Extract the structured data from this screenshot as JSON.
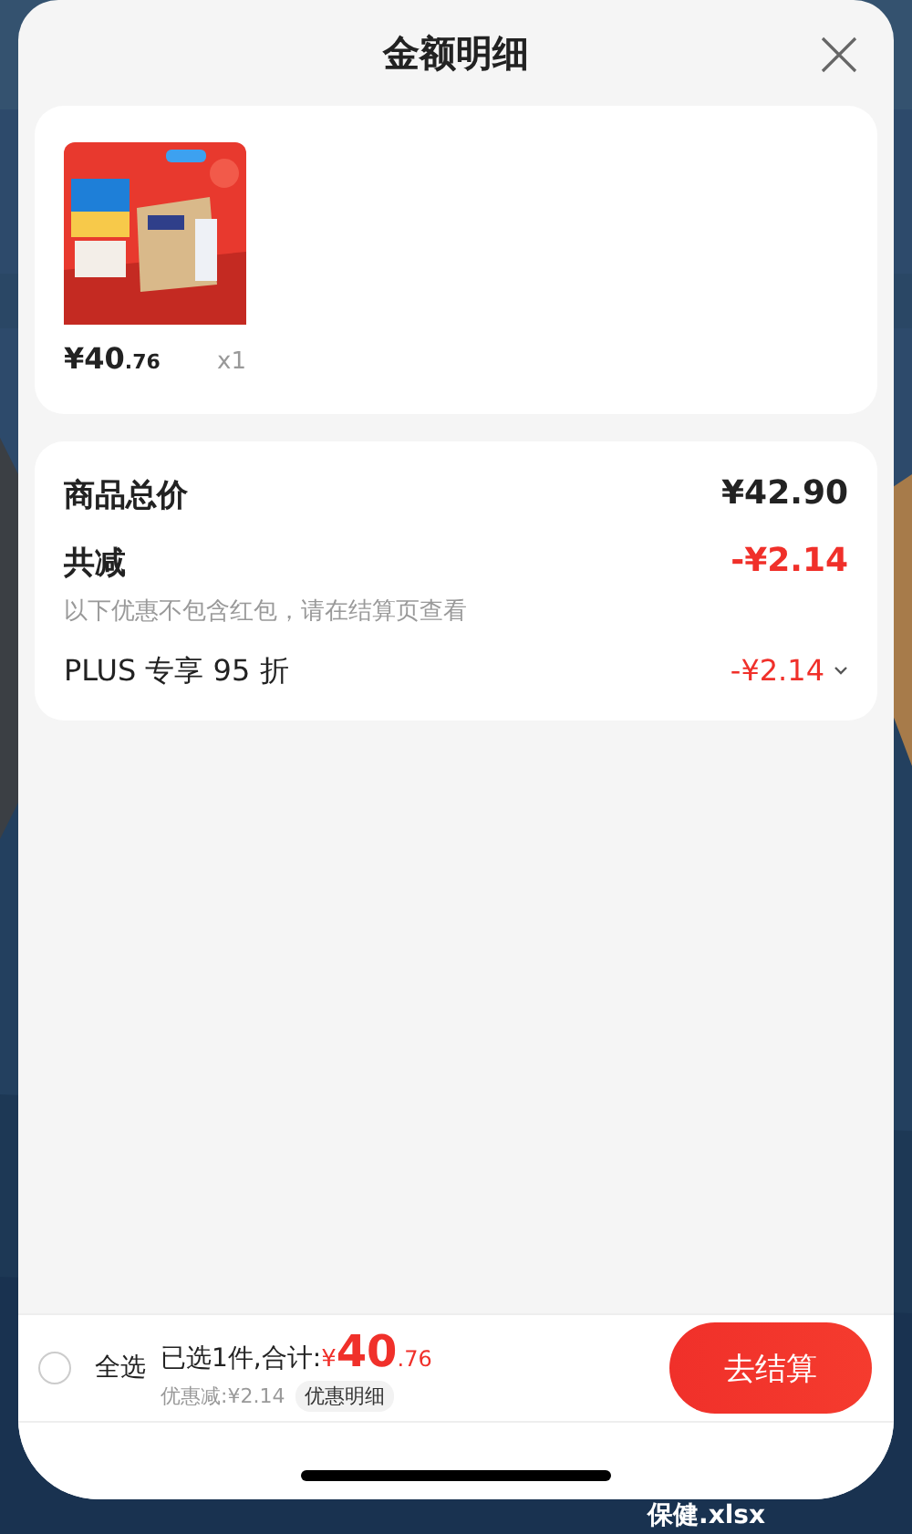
{
  "sheet": {
    "title": "金额明细"
  },
  "items": [
    {
      "kind": "picture",
      "price_main": "¥40",
      "price_cents": ".76",
      "quantity": "x1"
    }
  ],
  "summary": {
    "rows": [
      {
        "kind": "total",
        "label": "商品总价",
        "value": "¥42.90"
      },
      {
        "kind": "discount",
        "label": "共减",
        "value": "-¥2.14",
        "note": "以下优惠不包含红包，请在结算页查看"
      },
      {
        "kind": "detail",
        "label": "PLUS 专享 95 折",
        "value": "-¥2.14",
        "expanded": false
      }
    ]
  },
  "footer": {
    "select_all": {
      "label": "全选",
      "checked": false
    },
    "summary": "已选1件,合计:",
    "currency": "¥",
    "amount": "40",
    "cents": ".76",
    "discount": "优惠减:¥2.14",
    "detail_link": "优惠明细",
    "checkout": "去结算"
  },
  "desktop_file": "保健.xlsx"
}
